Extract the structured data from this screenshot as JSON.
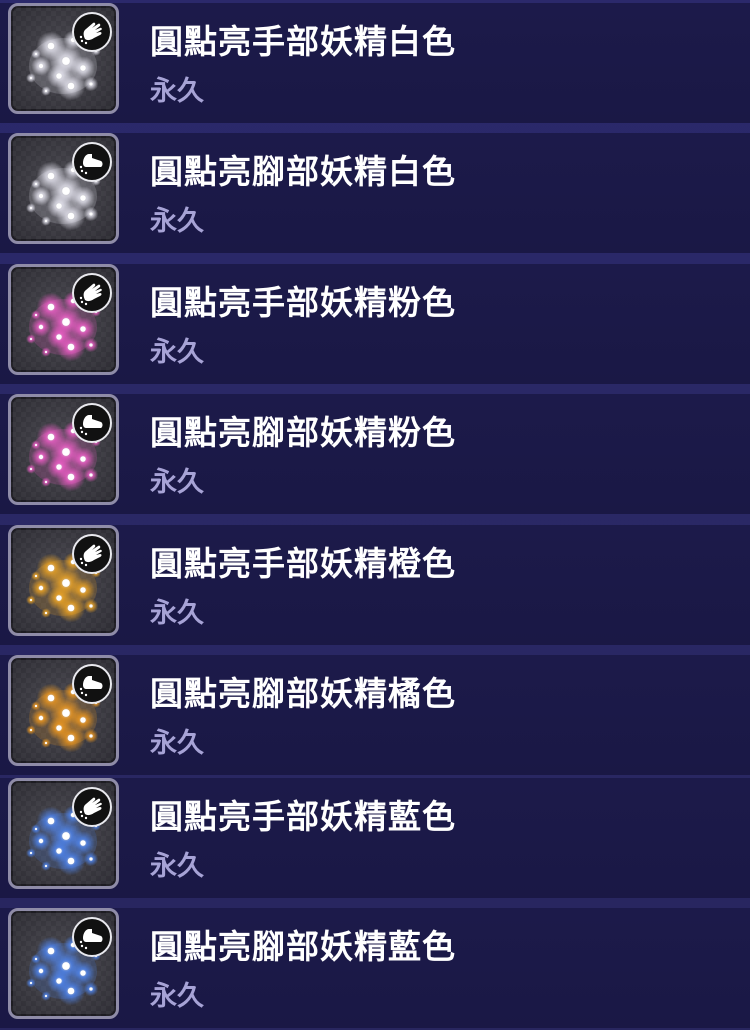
{
  "items": [
    {
      "title": "圓點亮手部妖精白色",
      "duration": "永久",
      "part_icon": "hand-icon",
      "color_name": "white",
      "effect_color": "#f4f3ff"
    },
    {
      "title": "圓點亮腳部妖精白色",
      "duration": "永久",
      "part_icon": "foot-icon",
      "color_name": "white",
      "effect_color": "#f4f3ff"
    },
    {
      "title": "圓點亮手部妖精粉色",
      "duration": "永久",
      "part_icon": "hand-icon",
      "color_name": "pink",
      "effect_color": "#ff5fd3"
    },
    {
      "title": "圓點亮腳部妖精粉色",
      "duration": "永久",
      "part_icon": "foot-icon",
      "color_name": "pink",
      "effect_color": "#ff5fd3"
    },
    {
      "title": "圓點亮手部妖精橙色",
      "duration": "永久",
      "part_icon": "hand-icon",
      "color_name": "orange",
      "effect_color": "#ffae1f"
    },
    {
      "title": "圓點亮腳部妖精橘色",
      "duration": "永久",
      "part_icon": "foot-icon",
      "color_name": "orange",
      "effect_color": "#ffa01a"
    },
    {
      "title": "圓點亮手部妖精藍色",
      "duration": "永久",
      "part_icon": "hand-icon",
      "color_name": "blue",
      "effect_color": "#4f8bff"
    },
    {
      "title": "圓點亮腳部妖精藍色",
      "duration": "永久",
      "part_icon": "foot-icon",
      "color_name": "blue",
      "effect_color": "#4f8bff"
    }
  ]
}
